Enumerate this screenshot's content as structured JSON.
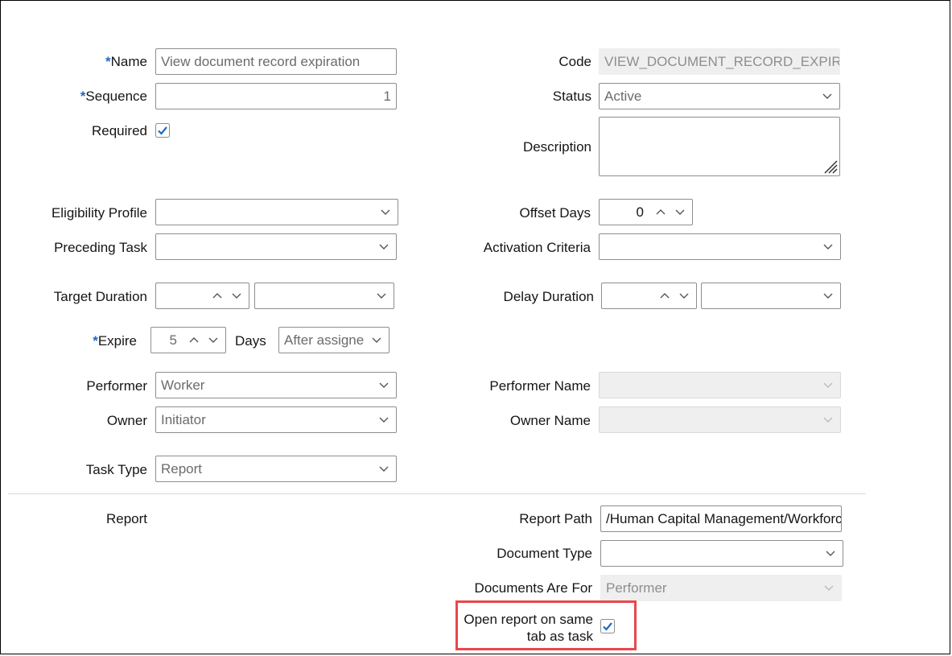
{
  "form": {
    "name": {
      "label": "Name",
      "required_mark": "*",
      "value": "View document record expiration"
    },
    "sequence": {
      "label": "Sequence",
      "required_mark": "*",
      "value": "1"
    },
    "required": {
      "label": "Required",
      "checked": true
    },
    "code": {
      "label": "Code",
      "value": "VIEW_DOCUMENT_RECORD_EXPIRATIC"
    },
    "status": {
      "label": "Status",
      "value": "Active"
    },
    "description": {
      "label": "Description",
      "value": ""
    },
    "eligibility_profile": {
      "label": "Eligibility Profile",
      "value": ""
    },
    "preceding_task": {
      "label": "Preceding Task",
      "value": ""
    },
    "offset_days": {
      "label": "Offset Days",
      "value": "0"
    },
    "activation_criteria": {
      "label": "Activation Criteria",
      "value": ""
    },
    "target_duration": {
      "label": "Target Duration",
      "value": "",
      "unit": ""
    },
    "delay_duration": {
      "label": "Delay Duration",
      "value": "",
      "unit": ""
    },
    "expire": {
      "label": "Expire",
      "required_mark": "*",
      "value": "5",
      "unit_label": "Days",
      "relative": "After assigned"
    },
    "performer": {
      "label": "Performer",
      "value": "Worker"
    },
    "owner": {
      "label": "Owner",
      "value": "Initiator"
    },
    "performer_name": {
      "label": "Performer Name",
      "value": ""
    },
    "owner_name": {
      "label": "Owner Name",
      "value": ""
    },
    "task_type": {
      "label": "Task Type",
      "value": "Report"
    },
    "report_section": {
      "label": "Report"
    },
    "report_path": {
      "label": "Report Path",
      "value": "/Human Capital Management/Workforce"
    },
    "document_type": {
      "label": "Document Type",
      "value": ""
    },
    "documents_are_for": {
      "label": "Documents Are For",
      "value": "Performer"
    },
    "open_same_tab": {
      "label_line1": "Open report on same",
      "label_line2": "tab as task",
      "checked": true
    }
  },
  "colors": {
    "accent": "#1e6ac3",
    "highlight": "#e8474c",
    "border": "#8e8e8e",
    "disabled_bg": "#efefef"
  }
}
